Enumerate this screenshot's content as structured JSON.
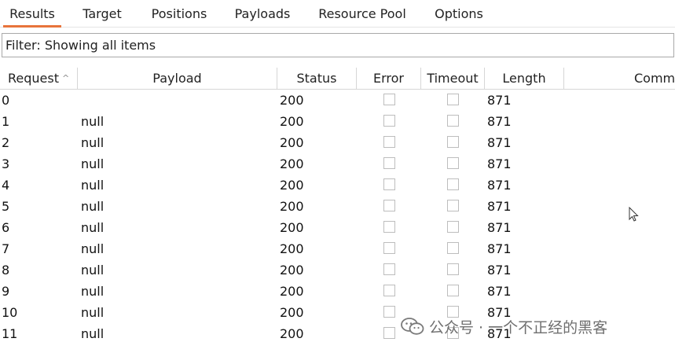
{
  "tabs": [
    {
      "label": "Results",
      "active": true
    },
    {
      "label": "Target"
    },
    {
      "label": "Positions"
    },
    {
      "label": "Payloads"
    },
    {
      "label": "Resource Pool"
    },
    {
      "label": "Options"
    }
  ],
  "filter": {
    "text": "Filter: Showing all items"
  },
  "table": {
    "columns": [
      "Request",
      "Payload",
      "Status",
      "Error",
      "Timeout",
      "Length",
      "Comm"
    ],
    "rows": [
      {
        "request": "0",
        "payload": "",
        "status": "200",
        "error": false,
        "timeout": false,
        "length": "871"
      },
      {
        "request": "1",
        "payload": "null",
        "status": "200",
        "error": false,
        "timeout": false,
        "length": "871"
      },
      {
        "request": "2",
        "payload": "null",
        "status": "200",
        "error": false,
        "timeout": false,
        "length": "871"
      },
      {
        "request": "3",
        "payload": "null",
        "status": "200",
        "error": false,
        "timeout": false,
        "length": "871"
      },
      {
        "request": "4",
        "payload": "null",
        "status": "200",
        "error": false,
        "timeout": false,
        "length": "871"
      },
      {
        "request": "5",
        "payload": "null",
        "status": "200",
        "error": false,
        "timeout": false,
        "length": "871"
      },
      {
        "request": "6",
        "payload": "null",
        "status": "200",
        "error": false,
        "timeout": false,
        "length": "871"
      },
      {
        "request": "7",
        "payload": "null",
        "status": "200",
        "error": false,
        "timeout": false,
        "length": "871"
      },
      {
        "request": "8",
        "payload": "null",
        "status": "200",
        "error": false,
        "timeout": false,
        "length": "871"
      },
      {
        "request": "9",
        "payload": "null",
        "status": "200",
        "error": false,
        "timeout": false,
        "length": "871"
      },
      {
        "request": "10",
        "payload": "null",
        "status": "200",
        "error": false,
        "timeout": false,
        "length": "871"
      },
      {
        "request": "11",
        "payload": "null",
        "status": "200",
        "error": false,
        "timeout": false,
        "length": "871"
      }
    ]
  },
  "watermark": {
    "text": "公众号 · 一个不正经的黑客",
    "icon": "wechat-icon"
  },
  "colors": {
    "tab_accent": "#e8743b",
    "grid_line": "#d6d6d6",
    "watermark": "#6f6f6f"
  }
}
